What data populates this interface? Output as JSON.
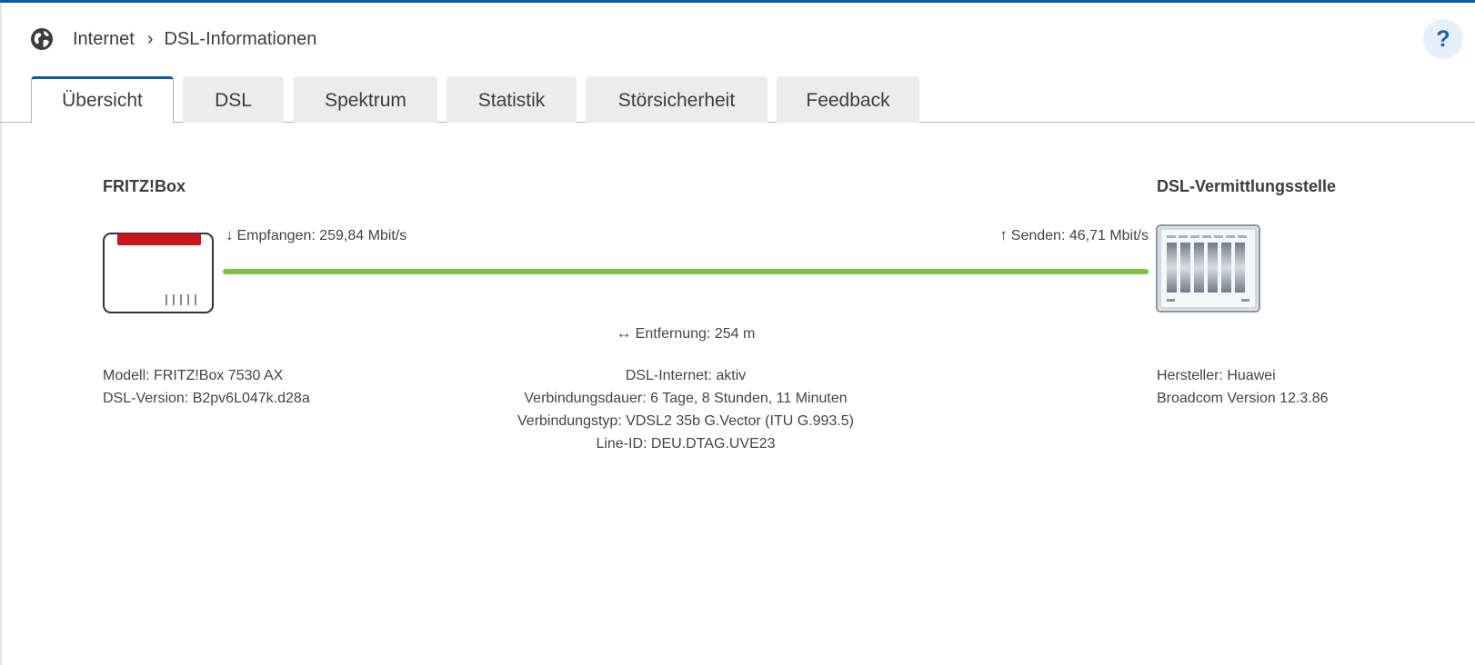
{
  "breadcrumb": {
    "section": "Internet",
    "page": "DSL-Informationen"
  },
  "help": {
    "label": "?"
  },
  "tabs": [
    "Übersicht",
    "DSL",
    "Spektrum",
    "Statistik",
    "Störsicherheit",
    "Feedback"
  ],
  "active_tab": "Übersicht",
  "left": {
    "heading": "FRITZ!Box",
    "model": "Modell: FRITZ!Box 7530 AX",
    "version": "DSL-Version: B2pv6L047k.d28a"
  },
  "right": {
    "heading": "DSL-Vermittlungsstelle",
    "manufacturer": "Hersteller: Huawei",
    "version": "Broadcom Version 12.3.86"
  },
  "link": {
    "receive": "Empfangen: 259,84 Mbit/s",
    "send": "Senden: 46,71 Mbit/s",
    "distance": "Entfernung: 254 m",
    "status_color": "#7dc242"
  },
  "details": {
    "internet": "DSL-Internet: aktiv",
    "duration": "Verbindungsdauer: 6 Tage, 8 Stunden, 11 Minuten",
    "type": "Verbindungstyp: VDSL2 35b G.Vector (ITU G.993.5)",
    "line_id": "Line-ID: DEU.DTAG.UVE23"
  },
  "icons": {
    "globe": "globe-icon",
    "receive": "arrow-down-icon",
    "send": "arrow-up-icon",
    "distance": "arrow-left-right-icon",
    "router": "fritzbox-router-icon",
    "exchange": "dsl-exchange-icon"
  },
  "colors": {
    "accent": "#0b5aa6",
    "router_red": "#c8161d"
  }
}
